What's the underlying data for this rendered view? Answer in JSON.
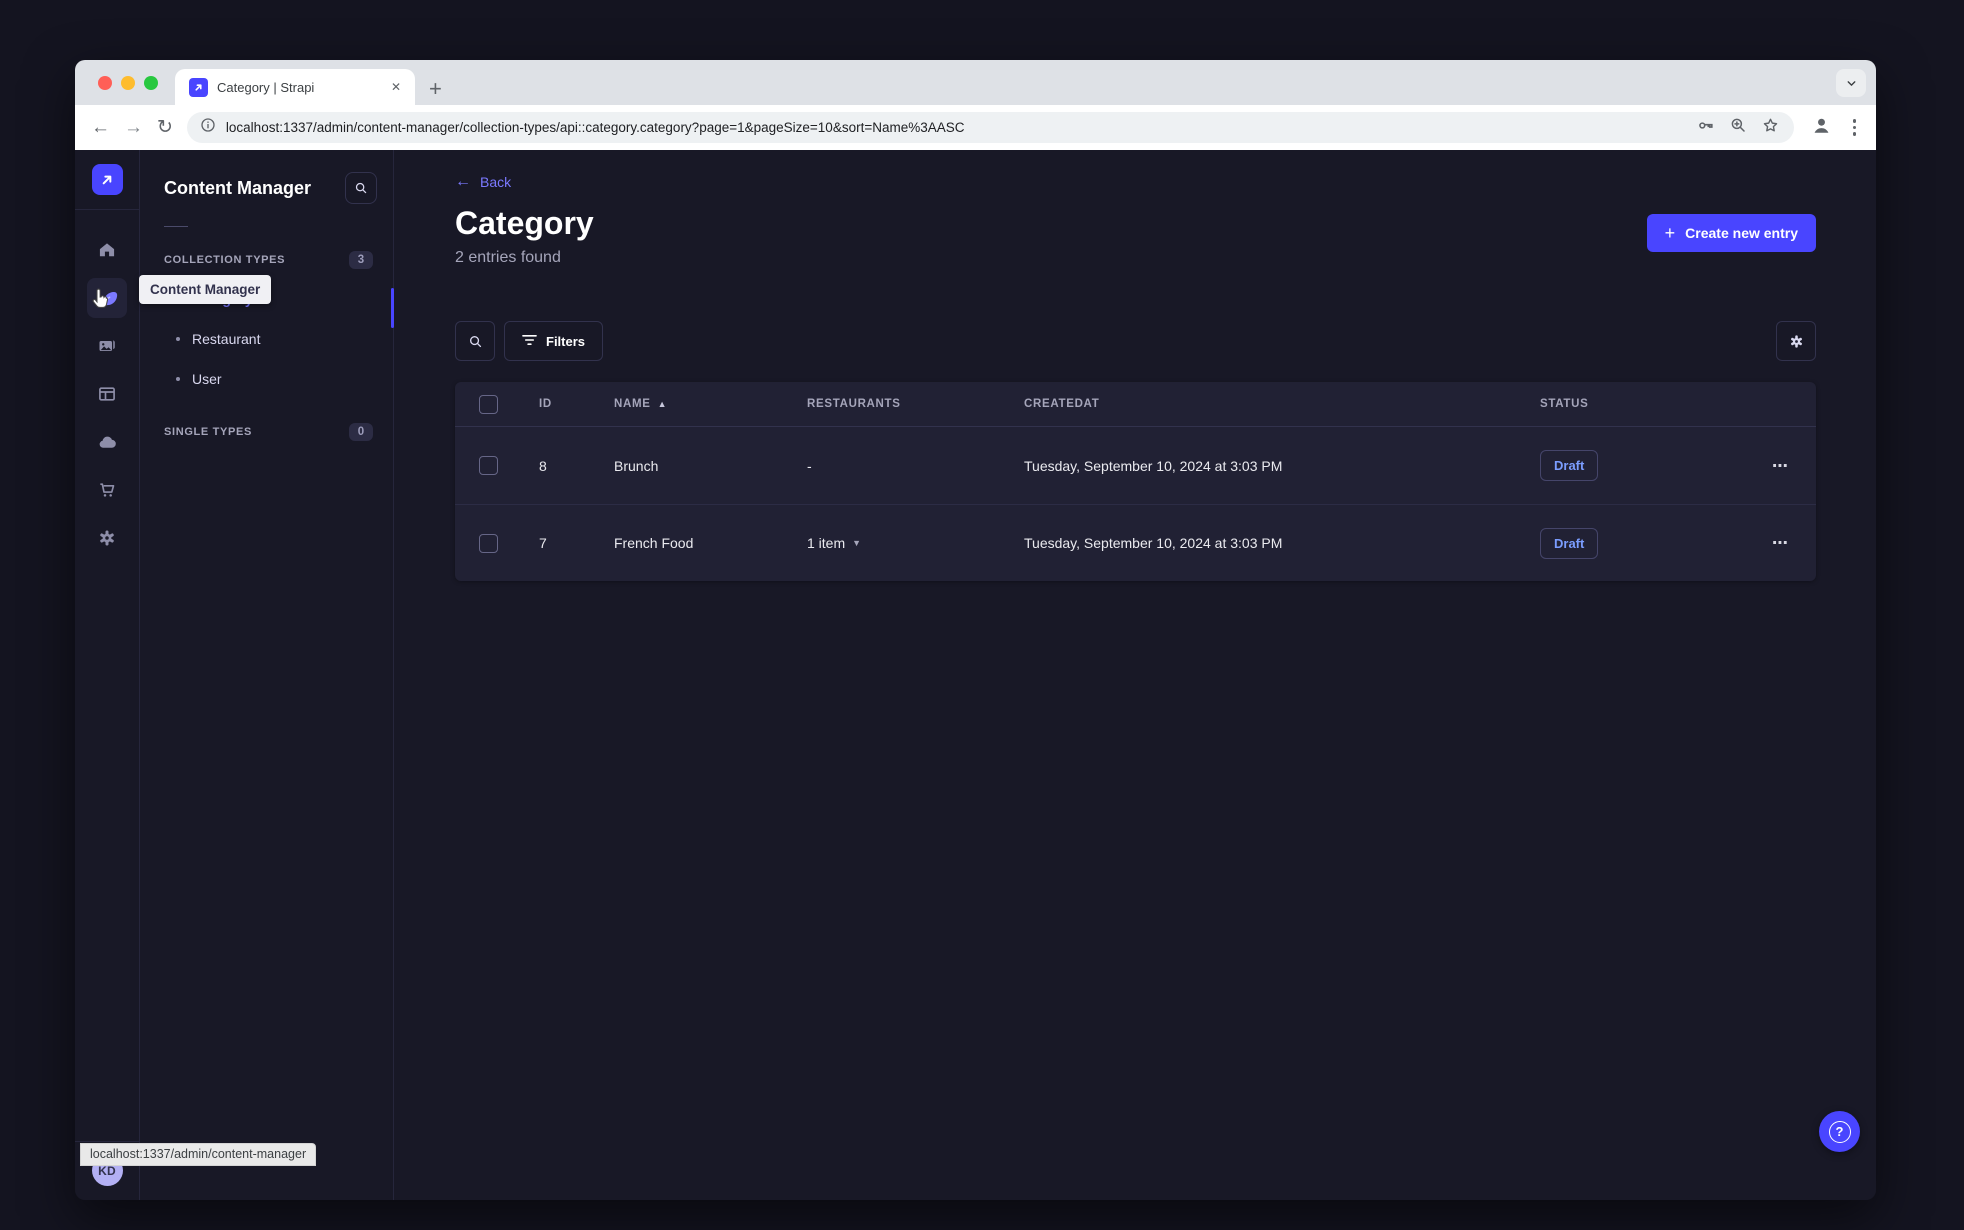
{
  "browser": {
    "tab": {
      "title": "Category | Strapi",
      "close_label": "✕",
      "new_tab_label": "+"
    },
    "url": "localhost:1337/admin/content-manager/collection-types/api::category.category?page=1&pageSize=10&sort=Name%3AASC",
    "status_link": "localhost:1337/admin/content-manager",
    "nav": {
      "back": "←",
      "forward": "→",
      "reload": "↻"
    }
  },
  "icons": {
    "rail": [
      "strapi-logo",
      "home",
      "content-manager",
      "media-library",
      "content-type-builder",
      "cloud",
      "marketplace",
      "settings"
    ],
    "urlbar_right": [
      "password-key",
      "zoom-magnifier",
      "bookmark-star"
    ],
    "chrome_right": [
      "profile",
      "overflow-menu"
    ]
  },
  "rail": {
    "avatar_initials": "KD"
  },
  "subnav": {
    "title": "Content Manager",
    "tooltip": "Content Manager",
    "collection_types_label": "COLLECTION TYPES",
    "collection_types_count": "3",
    "items": [
      {
        "label": "Category",
        "active": true
      },
      {
        "label": "Restaurant",
        "active": false
      },
      {
        "label": "User",
        "active": false
      }
    ],
    "single_types_label": "SINGLE TYPES",
    "single_types_count": "0"
  },
  "main": {
    "back_label": "Back",
    "title": "Category",
    "subtitle": "2 entries found",
    "create_button_label": "Create new entry",
    "filters_label": "Filters",
    "table": {
      "sort": {
        "column": "NAME",
        "direction": "asc"
      },
      "headers": {
        "id": "ID",
        "name": "NAME",
        "restaurants": "RESTAURANTS",
        "createdat": "CREATEDAT",
        "status": "STATUS"
      },
      "rows": [
        {
          "id": "8",
          "name": "Brunch",
          "restaurants": "-",
          "createdat": "Tuesday, September 10, 2024 at 3:03 PM",
          "status": "Draft"
        },
        {
          "id": "7",
          "name": "French Food",
          "restaurants": "1 item",
          "createdat": "Tuesday, September 10, 2024 at 3:03 PM",
          "status": "Draft"
        }
      ],
      "row_menu_glyph": "⋯"
    }
  },
  "colors": {
    "primary": "#4945ff",
    "link": "#7b79ff",
    "app_background": "#181826",
    "surface": "#212134",
    "border": "#32324d",
    "muted_text": "#a5a5ba",
    "draft_text": "#7b9dff"
  }
}
